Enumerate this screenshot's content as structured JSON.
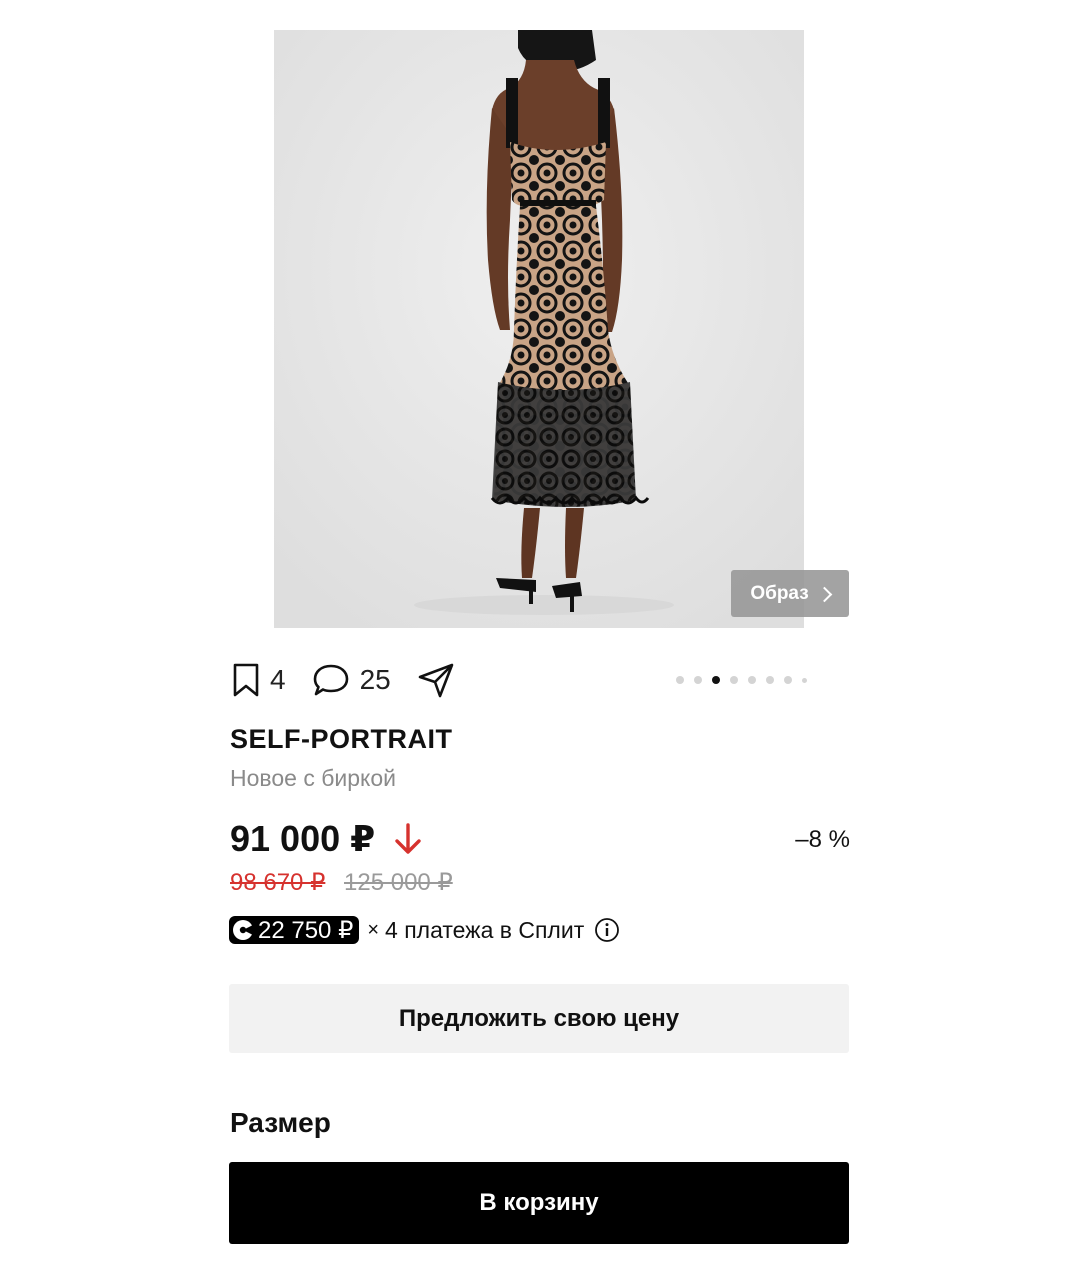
{
  "product": {
    "look_button_label": "Образ",
    "brand": "SELF-PORTRAIT",
    "condition": "Новое с биркой"
  },
  "actions": {
    "saves_count": "4",
    "comments_count": "25"
  },
  "gallery": {
    "total_images": 8,
    "active_index": 2
  },
  "pricing": {
    "current_price": "91 000 ₽",
    "discount": "–8 %",
    "previous_price": "98 670 ₽",
    "original_price": "125 000 ₽",
    "price_down_color": "#d6322e"
  },
  "split": {
    "installment_amount": "22 750 ₽",
    "multiplier": "×",
    "installment_text": "4 платежа в Сплит"
  },
  "buttons": {
    "offer_price_label": "Предложить свою цену",
    "add_to_cart_label": "В корзину"
  },
  "size": {
    "title": "Размер"
  },
  "icons": {
    "bookmark": "bookmark-icon",
    "comment": "comment-icon",
    "share": "share-icon",
    "price_down": "arrow-down-icon",
    "split_logo": "split-logo-icon",
    "info": "info-icon"
  }
}
